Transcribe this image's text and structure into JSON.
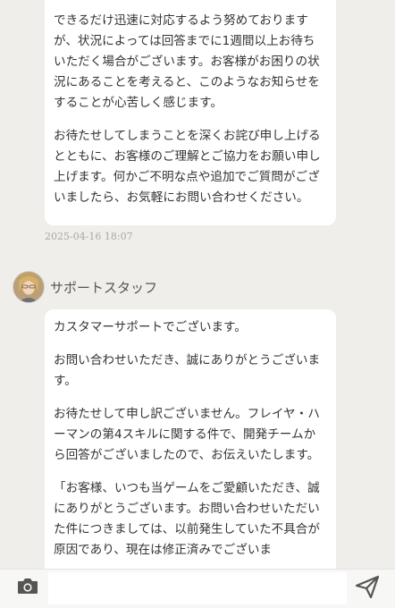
{
  "messages": [
    {
      "paragraphs": [
        "できるだけ迅速に対応するよう努めておりますが、状況によっては回答までに1週間以上お待ちいただく場合がございます。お客様がお困りの状況にあることを考えると、このようなお知らせをすることが心苦しく感じます。",
        "お待たせしてしまうことを深くお詫び申し上げるとともに、お客様のご理解とご協力をお願い申し上げます。何かご不明な点や追加でご質問がございましたら、お気軽にお問い合わせください。"
      ],
      "timestamp": "2025-04-16 18:07"
    },
    {
      "sender": "サポートスタッフ",
      "paragraphs": [
        "カスタマーサポートでございます。",
        "お問い合わせいただき、誠にありがとうございます。",
        "お待たせして申し訳ございません。フレイヤ・ハーマンの第4スキルに関する件で、開発チームから回答がございましたので、お伝えいたします。",
        "「お客様、いつも当ゲームをご愛顧いただき、誠にありがとうございます。お問い合わせいただいた件につきましては、以前発生していた不具合が原因であり、現在は修正済みでございま"
      ]
    }
  ],
  "composer": {
    "camera_icon": "camera-icon",
    "send_icon": "send-icon",
    "input_value": ""
  }
}
